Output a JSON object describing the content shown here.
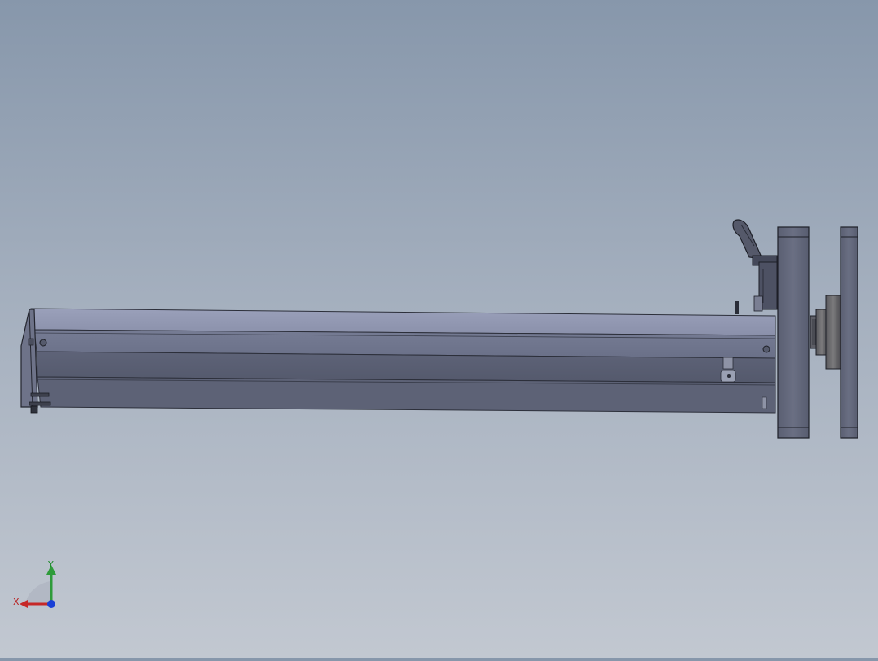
{
  "triad": {
    "x_label": "X",
    "y_label": "Y",
    "colors": {
      "x": "#c62828",
      "y": "#2e9b3a",
      "z": "#1a3fd6"
    }
  }
}
